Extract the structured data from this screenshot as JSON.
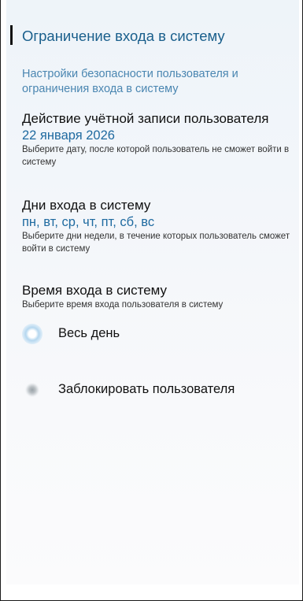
{
  "header": {
    "title": "Ограничение входа в систему",
    "subtitle": "Настройки безопасности пользователя и ограничения входа в систему"
  },
  "account_expiry": {
    "title": "Действие учётной записи пользователя",
    "value": "22 января 2026",
    "description": "Выберите дату, после которой пользователь не сможет войти в систему"
  },
  "login_days": {
    "title": "Дни входа в систему",
    "value": "пн, вт, ср, чт, пт, сб, вс",
    "description": "Выберите дни недели, в течение которых пользователь сможет войти в систему"
  },
  "login_time": {
    "title": "Время входа в систему",
    "description": "Выберите время входа пользователя в систему",
    "options": [
      {
        "label": "Весь день",
        "selected": true
      },
      {
        "label": "Заблокировать пользователя",
        "selected": false
      }
    ]
  }
}
